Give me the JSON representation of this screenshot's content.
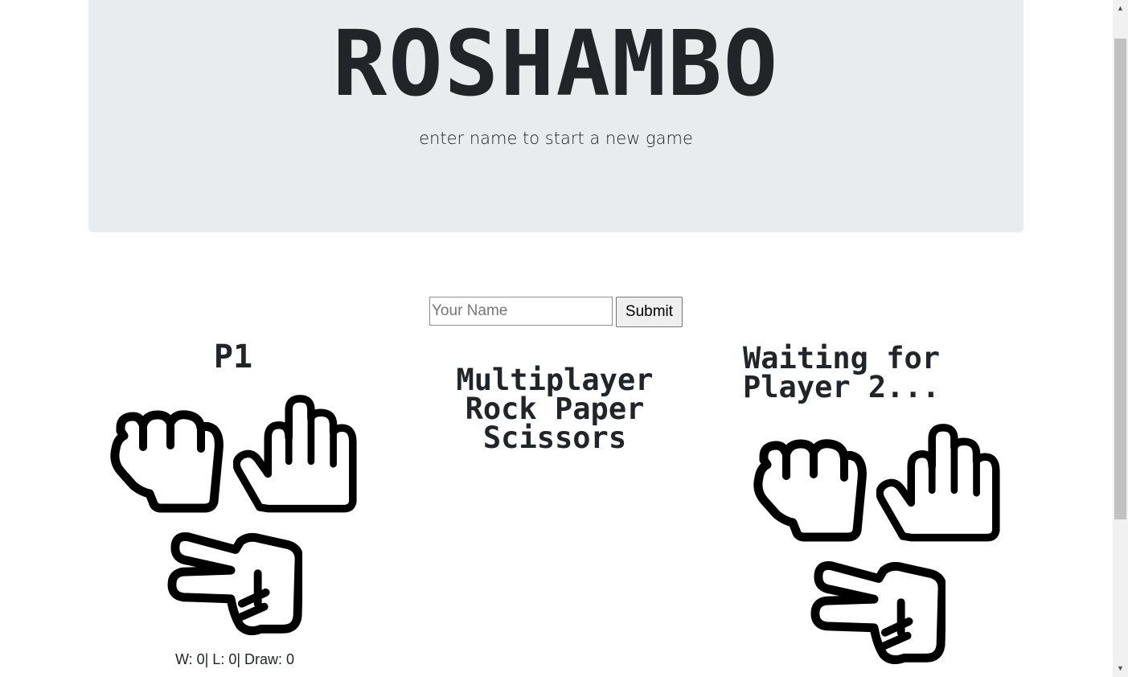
{
  "header": {
    "title": "ROSHAMBO",
    "subtitle": "enter name to start a new game"
  },
  "form": {
    "name_placeholder": "Your Name",
    "submit_label": "Submit"
  },
  "player1": {
    "title": "P1",
    "record": "W: 0| L: 0| Draw: 0",
    "choices": [
      "rock-icon",
      "paper-icon",
      "scissors-icon"
    ]
  },
  "center": {
    "line1": "Multiplayer",
    "line2": "Rock Paper",
    "line3": "Scissors"
  },
  "player2": {
    "line1": "Waiting for",
    "line2": "Player 2...",
    "choices": [
      "rock-icon",
      "paper-icon",
      "scissors-icon"
    ]
  },
  "colors": {
    "jumbotron_bg": "#e9ecef",
    "text": "#212529"
  }
}
